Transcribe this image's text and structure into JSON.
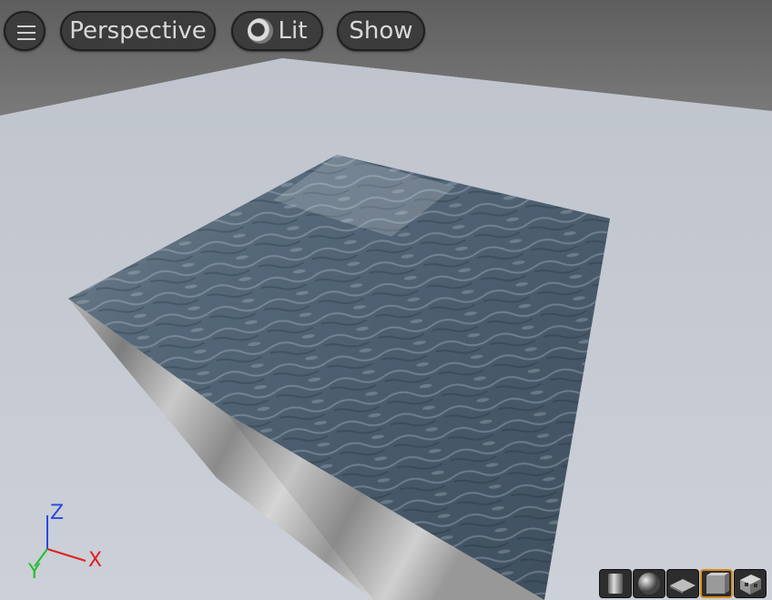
{
  "toolbar": {
    "menu_icon": "hamburger-icon",
    "view_mode_label": "Perspective",
    "lighting_mode_label": "Lit",
    "lighting_icon": "lit-sphere-icon",
    "show_label": "Show"
  },
  "axis_gizmo": {
    "z_label": "Z",
    "x_label": "X",
    "y_label": "Y",
    "colors": {
      "x": "#e02020",
      "y": "#1fbf2f",
      "z": "#2a48e0"
    }
  },
  "preview_shapes": [
    {
      "name": "cylinder",
      "icon": "cylinder-icon",
      "active": false
    },
    {
      "name": "sphere",
      "icon": "sphere-icon",
      "active": false
    },
    {
      "name": "plane",
      "icon": "plane-icon",
      "active": false
    },
    {
      "name": "cube",
      "icon": "cube-icon",
      "active": true
    },
    {
      "name": "mesh",
      "icon": "mesh-icon",
      "active": false
    }
  ],
  "colors": {
    "accent_active": "#d98b1a",
    "button_bg": "#3c3c3c",
    "floor": "#c6cad2",
    "sky": "#6b6b6b",
    "water": "#4b5b6a"
  }
}
